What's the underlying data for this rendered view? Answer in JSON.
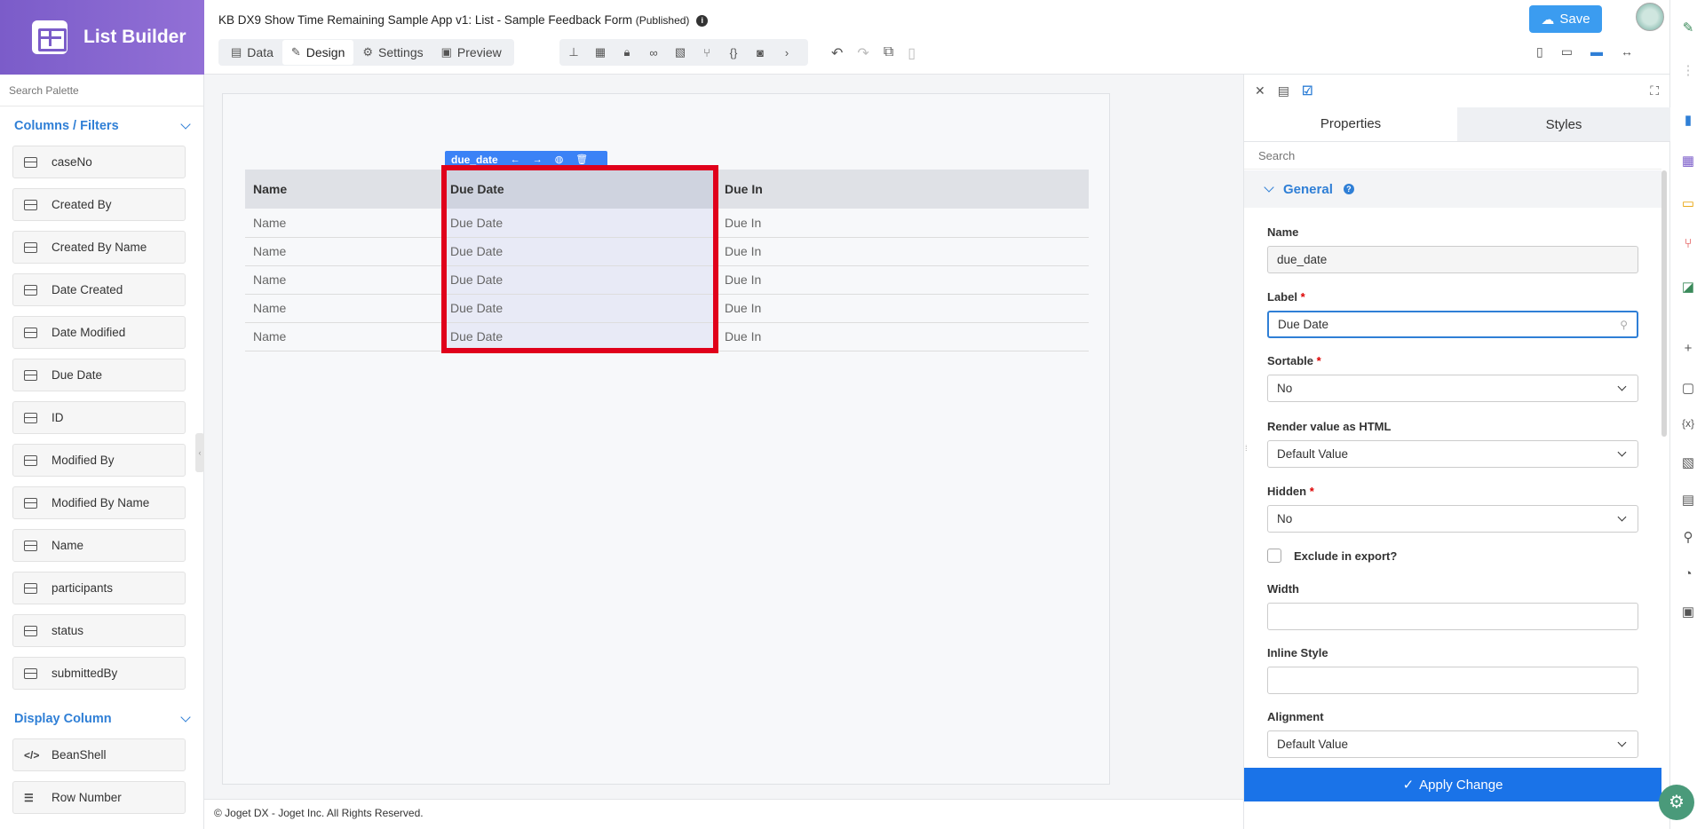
{
  "brand": {
    "title": "List Builder"
  },
  "header": {
    "app_title": "KB DX9 Show Time Remaining Sample App v1: List - Sample Feedback Form",
    "status": "(Published)",
    "tabs": [
      "Data",
      "Design",
      "Settings",
      "Preview"
    ],
    "active_tab": "Design",
    "save_label": "Save"
  },
  "palette": {
    "search_placeholder": "Search Palette",
    "columns_section": "Columns / Filters",
    "columns": [
      "caseNo",
      "Created By",
      "Created By Name",
      "Date Created",
      "Date Modified",
      "Due Date",
      "ID",
      "Modified By",
      "Modified By Name",
      "Name",
      "participants",
      "status",
      "submittedBy"
    ],
    "display_section": "Display Column",
    "display_items": [
      {
        "glyph": "</>",
        "label": "BeanShell"
      },
      {
        "glyph": "☰",
        "label": "Row Number"
      }
    ]
  },
  "grid": {
    "headers": [
      "Name",
      "Due Date",
      "Due In"
    ],
    "rows": [
      [
        "Name",
        "Due Date",
        "Due In"
      ],
      [
        "Name",
        "Due Date",
        "Due In"
      ],
      [
        "Name",
        "Due Date",
        "Due In"
      ],
      [
        "Name",
        "Due Date",
        "Due In"
      ],
      [
        "Name",
        "Due Date",
        "Due In"
      ]
    ],
    "selected_column_id": "due_date"
  },
  "footer": {
    "text": "© Joget DX - Joget Inc. All Rights Reserved."
  },
  "properties": {
    "tab_properties": "Properties",
    "tab_styles": "Styles",
    "search_placeholder": "Search",
    "section": "General",
    "name_label": "Name",
    "name_value": "due_date",
    "label_label": "Label",
    "label_value": "Due Date",
    "sortable_label": "Sortable",
    "sortable_value": "No",
    "render_html_label": "Render value as HTML",
    "render_html_value": "Default Value",
    "hidden_label": "Hidden",
    "hidden_value": "No",
    "exclude_label": "Exclude in export?",
    "width_label": "Width",
    "width_value": "",
    "inline_style_label": "Inline Style",
    "inline_style_value": "",
    "alignment_label": "Alignment",
    "alignment_value": "Default Value",
    "apply_label": "Apply Change"
  },
  "colors": {
    "brand": "#7b5cc9",
    "accent": "#2f7fd6",
    "selection": "#e0001b",
    "apply": "#1a73e8"
  }
}
